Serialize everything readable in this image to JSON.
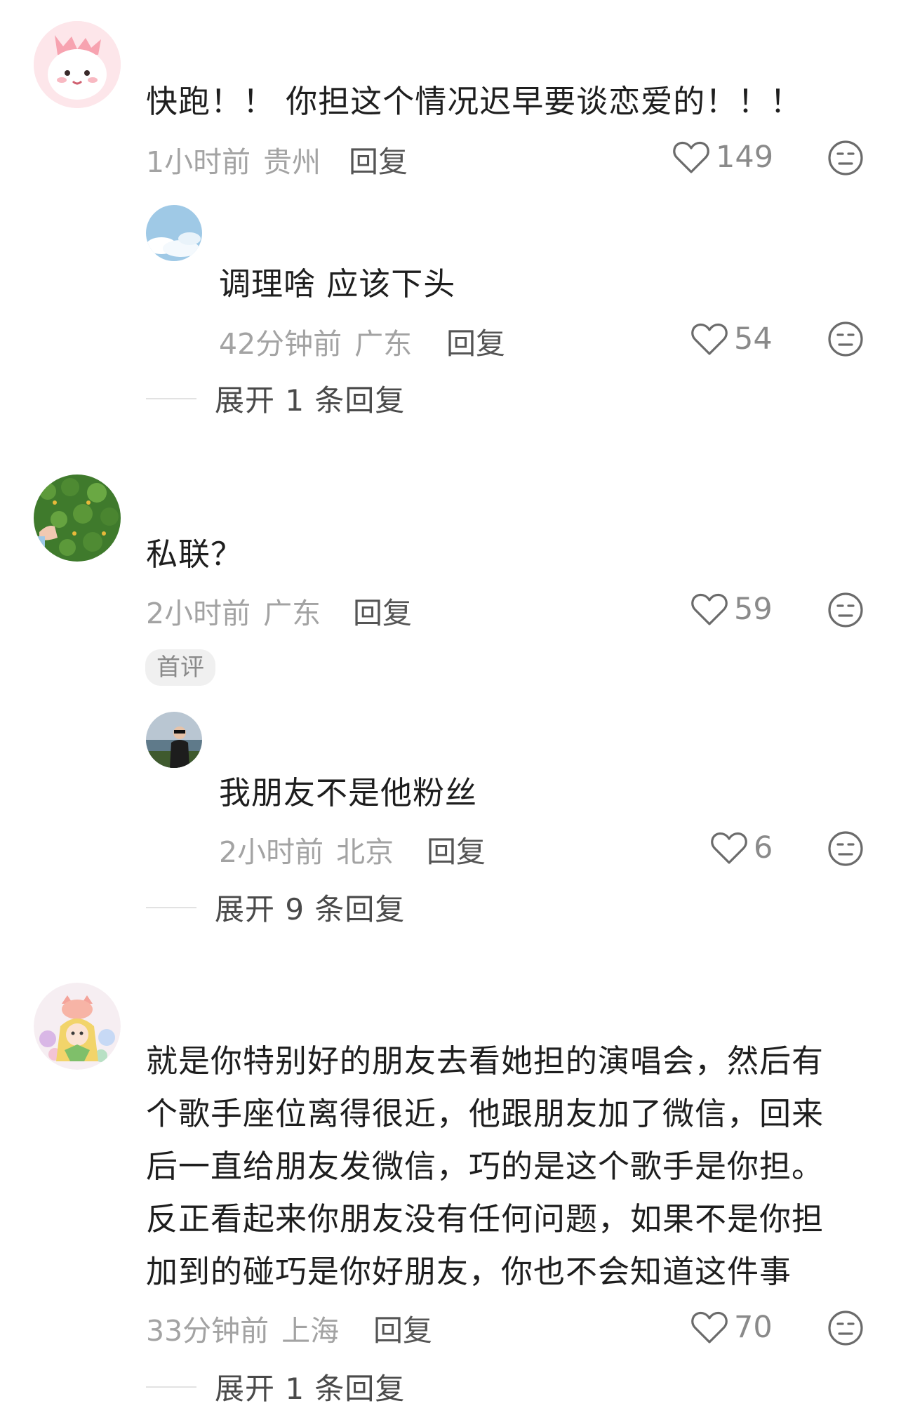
{
  "comments": [
    {
      "text": "快跑！！ 你担这个情况迟早要谈恋爱的！！！",
      "time": "1小时前",
      "location": "贵州",
      "reply_label": "回复",
      "likes": "149",
      "replies": [
        {
          "text": "调理啥 应该下头",
          "time": "42分钟前",
          "location": "广东",
          "reply_label": "回复",
          "likes": "54"
        }
      ],
      "expand_label": "展开 1 条回复"
    },
    {
      "text": "私联？",
      "time": "2小时前",
      "location": "广东",
      "reply_label": "回复",
      "likes": "59",
      "badge": "首评",
      "replies": [
        {
          "text": "我朋友不是他粉丝",
          "time": "2小时前",
          "location": "北京",
          "reply_label": "回复",
          "likes": "6"
        }
      ],
      "expand_label": "展开 9 条回复"
    },
    {
      "text_lines": [
        "就是你特别好的朋友去看她担的演唱会，然后有",
        "个歌手座位离得很近，他跟朋友加了微信，回来",
        "后一直给朋友发微信，巧的是这个歌手是你担。",
        "反正看起来你朋友没有任何问题，如果不是你担",
        "加到的碰巧是你好朋友，你也不会知道这件事"
      ],
      "time": "33分钟前",
      "location": "上海",
      "reply_label": "回复",
      "likes": "70",
      "expand_label": "展开 1 条回复"
    }
  ],
  "colors": {
    "text": "#1e1e1e",
    "meta": "#a3a3a3",
    "badge_bg": "#f0f0f0"
  }
}
